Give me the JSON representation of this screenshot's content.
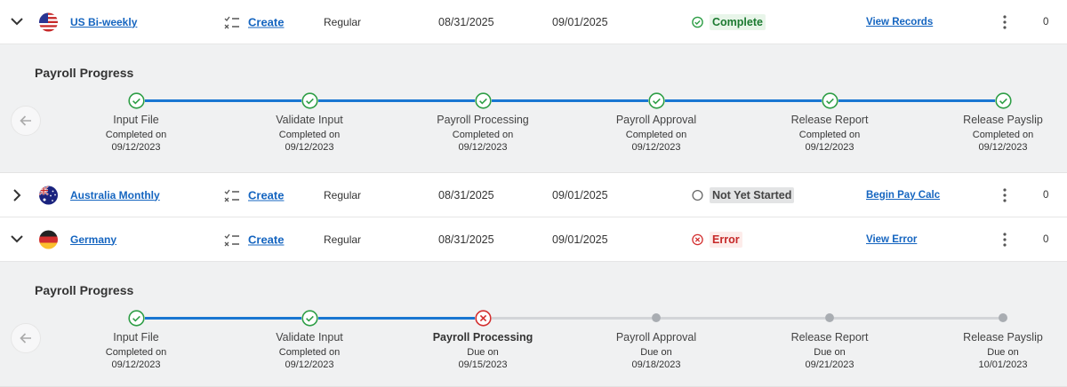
{
  "colors": {
    "link": "#1565c0",
    "progress_done": "#1976d2",
    "progress_pending": "#d3d5d8",
    "success": "#2e9e46",
    "error": "#d32f2f",
    "panel_bg": "#f0f1f2"
  },
  "payrolls": [
    {
      "name": "US Bi-weekly",
      "flag": "us-flag-icon",
      "expanded": true,
      "action": "Create",
      "type": "Regular",
      "period_end": "08/31/2025",
      "pay_date": "09/01/2025",
      "status": "Complete",
      "status_icon": "check-circle-icon",
      "link": "View Records",
      "count": "0"
    },
    {
      "name": "Australia Monthly",
      "flag": "australia-flag-icon",
      "expanded": false,
      "action": "Create",
      "type": "Regular",
      "period_end": "08/31/2025",
      "pay_date": "09/01/2025",
      "status": "Not Yet Started",
      "status_icon": "empty-circle-icon",
      "link": "Begin Pay Calc",
      "count": "0"
    },
    {
      "name": "Germany",
      "flag": "germany-flag-icon",
      "expanded": true,
      "action": "Create",
      "type": "Regular",
      "period_end": "08/31/2025",
      "pay_date": "09/01/2025",
      "status": "Error",
      "status_icon": "error-circle-icon",
      "link": "View Error",
      "count": "0"
    }
  ],
  "progress_panels": [
    {
      "title": "Payroll Progress",
      "steps": [
        {
          "label": "Input File",
          "sub": "Completed on",
          "date": "09/12/2023",
          "state": "complete"
        },
        {
          "label": "Validate Input",
          "sub": "Completed on",
          "date": "09/12/2023",
          "state": "complete"
        },
        {
          "label": "Payroll Processing",
          "sub": "Completed on",
          "date": "09/12/2023",
          "state": "complete"
        },
        {
          "label": "Payroll Approval",
          "sub": "Completed on",
          "date": "09/12/2023",
          "state": "complete"
        },
        {
          "label": "Release Report",
          "sub": "Completed on",
          "date": "09/12/2023",
          "state": "complete"
        },
        {
          "label": "Release Payslip",
          "sub": "Completed on",
          "date": "09/12/2023",
          "state": "complete"
        }
      ]
    },
    {
      "title": "Payroll Progress",
      "steps": [
        {
          "label": "Input File",
          "sub": "Completed on",
          "date": "09/12/2023",
          "state": "complete"
        },
        {
          "label": "Validate Input",
          "sub": "Completed on",
          "date": "09/12/2023",
          "state": "complete"
        },
        {
          "label": "Payroll Processing",
          "sub": "Due on",
          "date": "09/15/2023",
          "state": "error"
        },
        {
          "label": "Payroll Approval",
          "sub": "Due on",
          "date": "09/18/2023",
          "state": "pending"
        },
        {
          "label": "Release Report",
          "sub": "Due on",
          "date": "09/21/2023",
          "state": "pending"
        },
        {
          "label": "Release Payslip",
          "sub": "Due on",
          "date": "10/01/2023",
          "state": "pending"
        }
      ]
    }
  ]
}
